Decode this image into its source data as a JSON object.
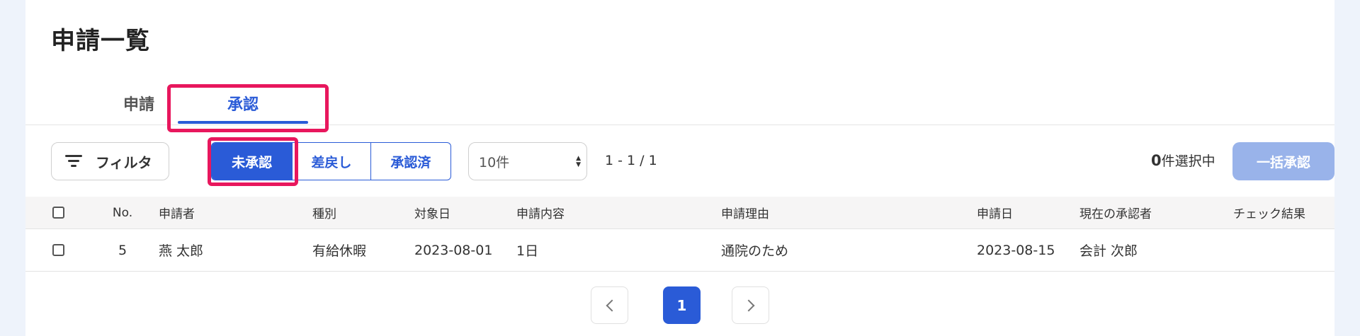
{
  "page": {
    "title": "申請一覧"
  },
  "tabs": [
    {
      "label": "申請",
      "active": false
    },
    {
      "label": "承認",
      "active": true
    }
  ],
  "toolbar": {
    "filter_label": "フィルタ",
    "status_filters": [
      {
        "label": "未承認",
        "active": true
      },
      {
        "label": "差戻し",
        "active": false
      },
      {
        "label": "承認済",
        "active": false
      }
    ],
    "per_page": {
      "selected": "10件"
    },
    "range_text": "1 - 1 / 1",
    "selected_count": "0",
    "selected_suffix": "件選択中",
    "bulk_approve_label": "一括承認"
  },
  "table": {
    "headers": {
      "no": "No.",
      "applicant": "申請者",
      "type": "種別",
      "target_date": "対象日",
      "content": "申請内容",
      "reason": "申請理由",
      "applied_date": "申請日",
      "approver": "現在の承認者",
      "check_result": "チェック結果"
    },
    "rows": [
      {
        "no": "5",
        "applicant": "燕 太郎",
        "type": "有給休暇",
        "target_date": "2023-08-01",
        "content": "1日",
        "reason": "通院のため",
        "applied_date": "2023-08-15",
        "approver": "会計 次郎",
        "check_result": ""
      }
    ]
  },
  "pagination": {
    "current_page": "1"
  },
  "colors": {
    "accent": "#2a5bd7",
    "highlight": "#e8175d",
    "bulk_disabled": "#99b3ea"
  }
}
